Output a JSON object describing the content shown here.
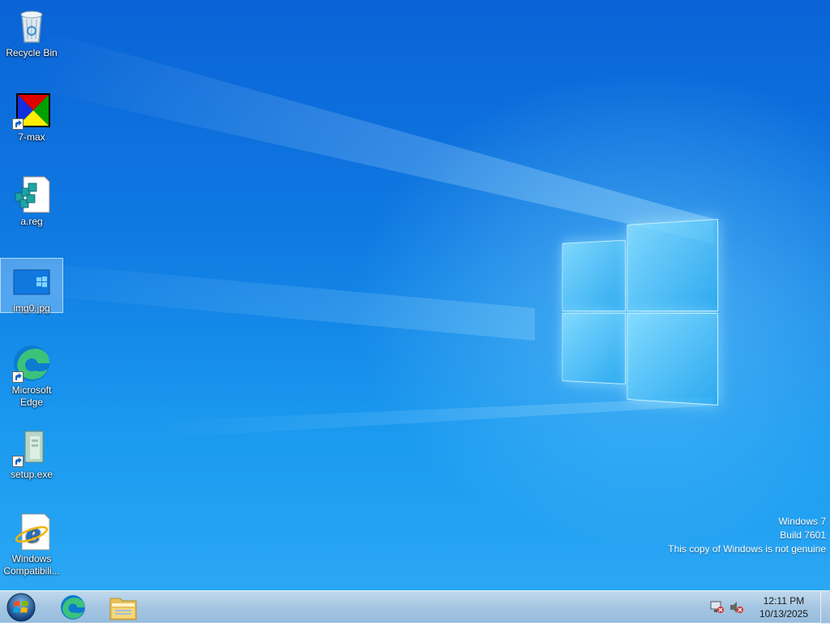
{
  "desktop": {
    "icons": [
      {
        "label": "Recycle Bin",
        "icon": "recycle-bin-icon"
      },
      {
        "label": "7-max",
        "icon": "7-max-icon"
      },
      {
        "label": "a.reg",
        "icon": "registry-file-icon"
      },
      {
        "label": "img0.jpg",
        "icon": "image-file-icon"
      },
      {
        "label": "Microsoft Edge",
        "icon": "edge-icon"
      },
      {
        "label": "setup.exe",
        "icon": "setup-exe-icon"
      },
      {
        "label": "Windows Compatibili...",
        "icon": "ie-icon"
      }
    ],
    "selected_icon": "img0.jpg"
  },
  "watermark": {
    "line1": "Windows 7",
    "line2": "Build 7601",
    "line3": "This copy of Windows is not genuine"
  },
  "taskbar": {
    "pinned": [
      {
        "name": "Microsoft Edge",
        "icon": "edge-icon"
      },
      {
        "name": "Windows Explorer",
        "icon": "folder-icon"
      }
    ],
    "tray": {
      "icons": [
        "network-icon",
        "volume-muted-icon"
      ],
      "time": "12:11 PM",
      "date": "10/13/2025"
    }
  },
  "colors": {
    "wallpaper_accent": "#0f7ae2",
    "taskbar": "#a8c6e0"
  }
}
